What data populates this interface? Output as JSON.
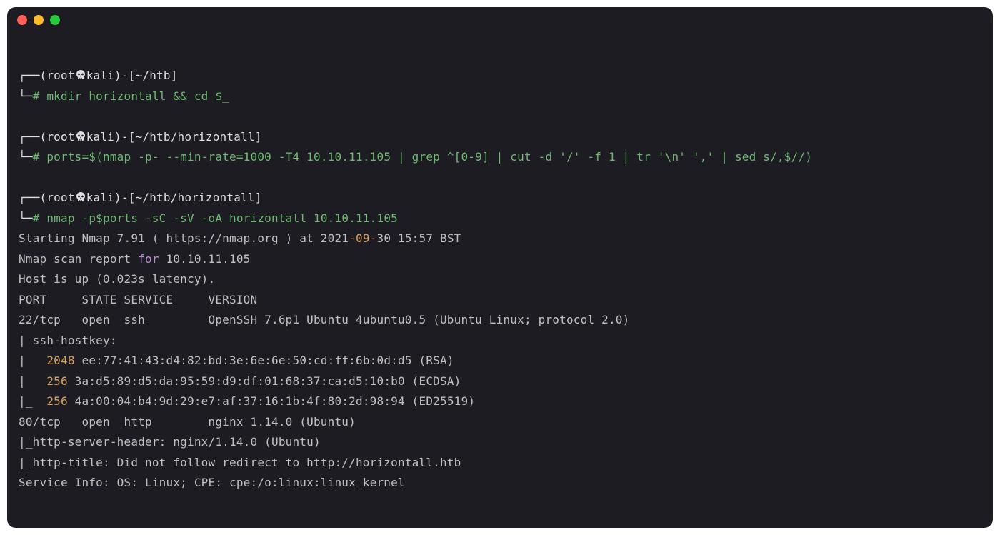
{
  "window": {
    "buttons": {
      "close": "",
      "minimize": "",
      "zoom": ""
    }
  },
  "prompt": {
    "top_left": "┌──(",
    "bot_left": "└─",
    "close_paren": ")",
    "dash_open": "-[",
    "bracket_close": "]",
    "user": "root",
    "host": "kali",
    "hash": "#"
  },
  "skull_svg_title": "skull",
  "blocks": [
    {
      "cwd": "~/htb",
      "command": "mkdir horizontall && cd $_",
      "output": []
    },
    {
      "cwd": "~/htb/horizontall",
      "command": "ports=$(nmap -p- --min-rate=1000 -T4 10.10.11.105 | grep ^[0-9] | cut -d '/' -f 1 | tr '\\n' ',' | sed s/,$//)",
      "output": []
    },
    {
      "cwd": "~/htb/horizontall",
      "command": "nmap -p$ports -sC -sV -oA horizontall 10.10.11.105",
      "output": [
        {
          "segments": [
            {
              "t": "Starting Nmap 7.91 ( https://nmap.org ) at 2021",
              "c": "gray"
            },
            {
              "t": "-09-",
              "c": "orange"
            },
            {
              "t": "30 15:57 BST",
              "c": "gray"
            }
          ]
        },
        {
          "segments": [
            {
              "t": "Nmap scan report ",
              "c": "gray"
            },
            {
              "t": "for",
              "c": "purple"
            },
            {
              "t": " 10.10.11.105",
              "c": "gray"
            }
          ]
        },
        {
          "segments": [
            {
              "t": "Host is up (0.023s latency).",
              "c": "gray"
            }
          ]
        },
        {
          "segments": [
            {
              "t": "",
              "c": "gray"
            }
          ]
        },
        {
          "segments": [
            {
              "t": "PORT     STATE SERVICE     VERSION",
              "c": "gray"
            }
          ]
        },
        {
          "segments": [
            {
              "t": "22/tcp   open  ssh         OpenSSH 7.6p1 Ubuntu 4ubuntu0.5 (Ubuntu Linux; protocol 2.0)",
              "c": "gray"
            }
          ]
        },
        {
          "segments": [
            {
              "t": "| ssh-hostkey:",
              "c": "gray"
            }
          ]
        },
        {
          "segments": [
            {
              "t": "|   ",
              "c": "gray"
            },
            {
              "t": "2048",
              "c": "orange"
            },
            {
              "t": " ee:77:41:43:d4:82:bd:3e:6e:6e:50:cd:ff:6b:0d:d5 (RSA)",
              "c": "gray"
            }
          ]
        },
        {
          "segments": [
            {
              "t": "|   ",
              "c": "gray"
            },
            {
              "t": "256",
              "c": "orange"
            },
            {
              "t": " 3a:d5:89:d5:da:95:59:d9:df:01:68:37:ca:d5:10:b0 (ECDSA)",
              "c": "gray"
            }
          ]
        },
        {
          "segments": [
            {
              "t": "|_  ",
              "c": "gray"
            },
            {
              "t": "256",
              "c": "orange"
            },
            {
              "t": " 4a:00:04:b4:9d:29:e7:af:37:16:1b:4f:80:2d:98:94 (ED25519)",
              "c": "gray"
            }
          ]
        },
        {
          "segments": [
            {
              "t": "80/tcp   open  http        nginx 1.14.0 (Ubuntu)",
              "c": "gray"
            }
          ]
        },
        {
          "segments": [
            {
              "t": "|_http-server-header: nginx/1.14.0 (Ubuntu)",
              "c": "gray"
            }
          ]
        },
        {
          "segments": [
            {
              "t": "|_http-title: Did not follow redirect to http://horizontall.htb",
              "c": "gray"
            }
          ]
        },
        {
          "segments": [
            {
              "t": "Service Info: OS: Linux; CPE: cpe:/o:linux:linux_kernel",
              "c": "gray"
            }
          ]
        }
      ]
    }
  ]
}
